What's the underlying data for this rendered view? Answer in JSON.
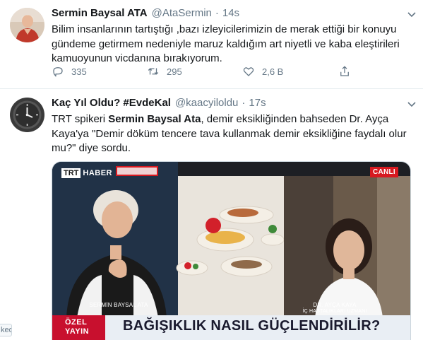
{
  "tweets": [
    {
      "name": "Sermin Baysal ATA",
      "handle": "@AtaSermin",
      "separator": "·",
      "time": "14s",
      "text": "Bilim insanlarının tartıştığı ,bazı izleyicilerimizin de merak ettiği bir konuyu gündeme getirmem nedeniyle maruz kaldığım art niyetli ve kaba eleştirileri kamuoyunun vicdanına bırakıyorum.",
      "actions": {
        "replies": "335",
        "retweets": "295",
        "likes": "2,6 B"
      },
      "icons": [
        "reply-icon",
        "retweet-icon",
        "heart-icon",
        "share-icon",
        "chevron-down-icon"
      ]
    },
    {
      "name": "Kaç Yıl Oldu? #EvdeKal",
      "handle": "@kaacyiloldu",
      "separator": "·",
      "time": "17s",
      "text_parts": {
        "p1": "TRT spikeri ",
        "bold": "Sermin Baysal Ata",
        "p2": ", demir eksikliğinden bahseden Dr. Ayça Kaya'ya \"Demir döküm tencere tava kullanmak demir eksikliğine faydalı olur mu?\" diye sordu."
      },
      "media": {
        "logo_trt": "TRT",
        "logo_haber": "HABER",
        "live_badge": "CANLI",
        "caption_left": "SERMİN BAYSAL ATA",
        "caption_right_name": "DR. AYÇA KAYA",
        "caption_right_title": "İÇ HASTALIKLARI UZMANI",
        "ozel_line1": "ÖZEL",
        "ozel_line2": "YAYIN",
        "headline": "BAĞIŞIKLIK NASIL GÜÇLENDİRİLİR?"
      }
    }
  ],
  "side_tag": "ked",
  "colors": {
    "text_primary": "#14171a",
    "text_secondary": "#657786",
    "divider": "#e6ecf0",
    "live_red": "#d71920",
    "ozel_red": "#c8102e"
  }
}
